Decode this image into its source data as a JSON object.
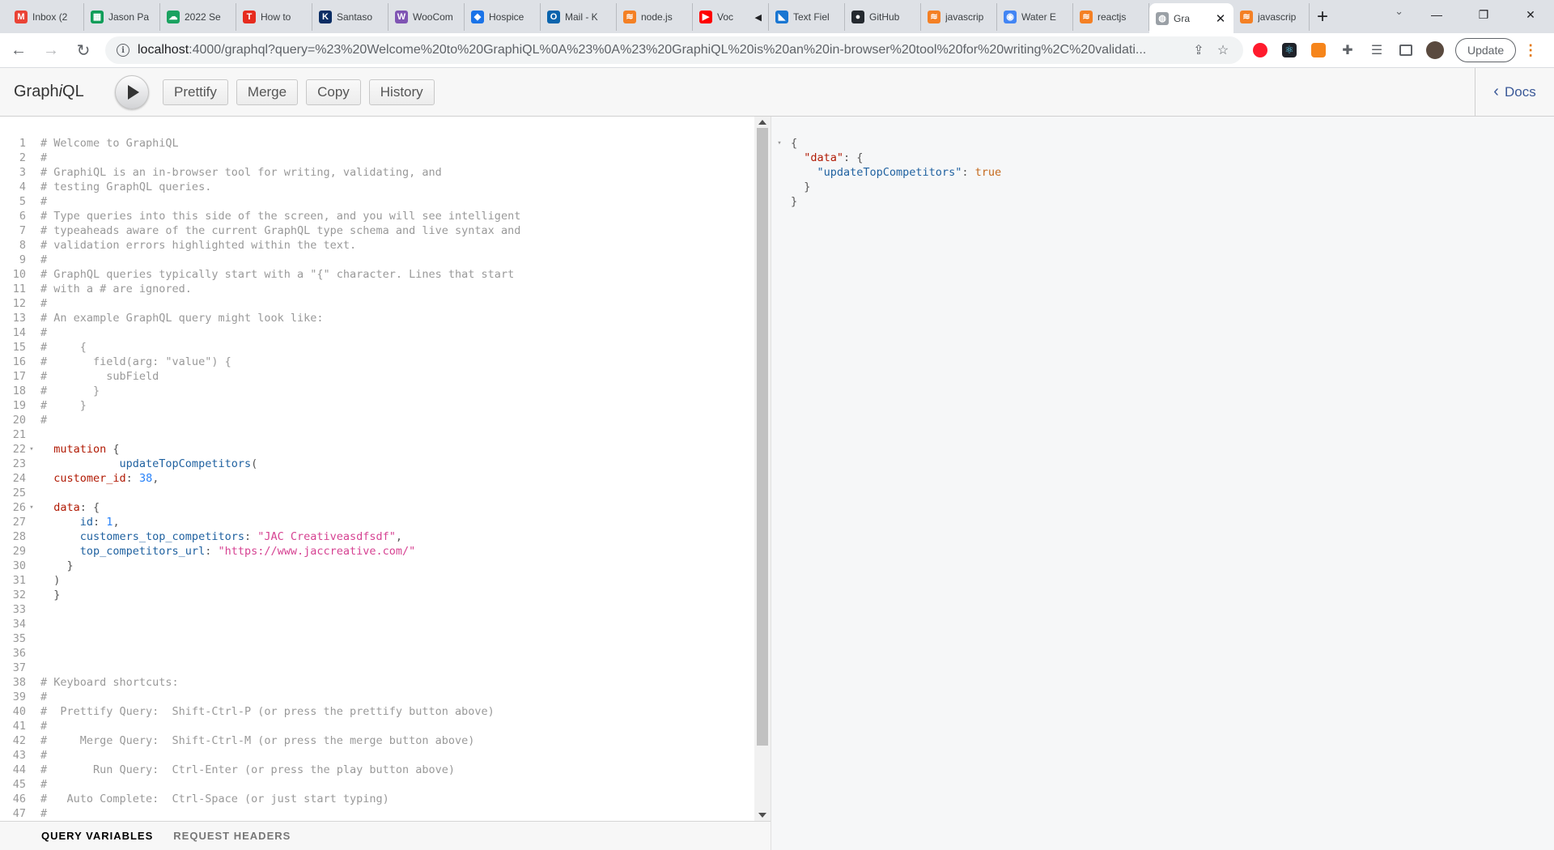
{
  "browser": {
    "tabs": [
      {
        "title": "Inbox (2",
        "icon": "gmail-icon",
        "color": "#ea4335",
        "glyph": "M"
      },
      {
        "title": "Jason Pa",
        "icon": "sheets-icon",
        "color": "#0f9d58",
        "glyph": "▦"
      },
      {
        "title": "2022 Se",
        "icon": "cloud-icon",
        "color": "#1aa260",
        "glyph": "☁"
      },
      {
        "title": "How to",
        "icon": "ted-icon",
        "color": "#e62b1e",
        "glyph": "T"
      },
      {
        "title": "Santaso",
        "icon": "k-icon",
        "color": "#0b2d64",
        "glyph": "K"
      },
      {
        "title": "WooCom",
        "icon": "woo-icon",
        "color": "#7f54b3",
        "glyph": "W"
      },
      {
        "title": "Hospice",
        "icon": "diamond-icon",
        "color": "#1a73e8",
        "glyph": "◆"
      },
      {
        "title": "Mail - K",
        "icon": "outlook-icon",
        "color": "#0a64ad",
        "glyph": "O"
      },
      {
        "title": "node.js",
        "icon": "stackoverflow-icon",
        "color": "#f48024",
        "glyph": "≋"
      },
      {
        "title": "Voc",
        "icon": "youtube-icon",
        "color": "#ff0000",
        "glyph": "▶",
        "audio": true
      },
      {
        "title": "Text Fiel",
        "icon": "mui-icon",
        "color": "#1976d2",
        "glyph": "◣"
      },
      {
        "title": "GitHub",
        "icon": "github-icon",
        "color": "#24292f",
        "glyph": "●"
      },
      {
        "title": "javascrip",
        "icon": "stackoverflow-icon",
        "color": "#f48024",
        "glyph": "≋"
      },
      {
        "title": "Water E",
        "icon": "water-icon",
        "color": "#4285f4",
        "glyph": "◉"
      },
      {
        "title": "reactjs",
        "icon": "stackoverflow-icon",
        "color": "#f48024",
        "glyph": "≋"
      },
      {
        "title": "Gra",
        "icon": "globe-icon",
        "color": "#9aa0a6",
        "glyph": "◍",
        "active": true
      },
      {
        "title": "javascrip",
        "icon": "stackoverflow-icon",
        "color": "#f48024",
        "glyph": "≋"
      }
    ],
    "url_host": "localhost",
    "url_rest": ":4000/graphql?query=%23%20Welcome%20to%20GraphiQL%0A%23%0A%23%20GraphiQL%20is%20an%20in-browser%20tool%20for%20writing%2C%20validati...",
    "update_label": "Update"
  },
  "graphiql": {
    "logo_pre": "Graph",
    "logo_em": "i",
    "logo_post": "QL",
    "buttons": {
      "prettify": "Prettify",
      "merge": "Merge",
      "copy": "Copy",
      "history": "History"
    },
    "docs_label": "Docs",
    "vars_tabs": {
      "variables": "QUERY VARIABLES",
      "headers": "REQUEST HEADERS"
    }
  },
  "query_lines": [
    {
      "n": 1,
      "t": [
        [
          "c-comment",
          "# Welcome to GraphiQL"
        ]
      ]
    },
    {
      "n": 2,
      "t": [
        [
          "c-comment",
          "#"
        ]
      ]
    },
    {
      "n": 3,
      "t": [
        [
          "c-comment",
          "# GraphiQL is an in-browser tool for writing, validating, and"
        ]
      ]
    },
    {
      "n": 4,
      "t": [
        [
          "c-comment",
          "# testing GraphQL queries."
        ]
      ]
    },
    {
      "n": 5,
      "t": [
        [
          "c-comment",
          "#"
        ]
      ]
    },
    {
      "n": 6,
      "t": [
        [
          "c-comment",
          "# Type queries into this side of the screen, and you will see intelligent"
        ]
      ]
    },
    {
      "n": 7,
      "t": [
        [
          "c-comment",
          "# typeaheads aware of the current GraphQL type schema and live syntax and"
        ]
      ]
    },
    {
      "n": 8,
      "t": [
        [
          "c-comment",
          "# validation errors highlighted within the text."
        ]
      ]
    },
    {
      "n": 9,
      "t": [
        [
          "c-comment",
          "#"
        ]
      ]
    },
    {
      "n": 10,
      "t": [
        [
          "c-comment",
          "# GraphQL queries typically start with a \"{\" character. Lines that start"
        ]
      ]
    },
    {
      "n": 11,
      "t": [
        [
          "c-comment",
          "# with a # are ignored."
        ]
      ]
    },
    {
      "n": 12,
      "t": [
        [
          "c-comment",
          "#"
        ]
      ]
    },
    {
      "n": 13,
      "t": [
        [
          "c-comment",
          "# An example GraphQL query might look like:"
        ]
      ]
    },
    {
      "n": 14,
      "t": [
        [
          "c-comment",
          "#"
        ]
      ]
    },
    {
      "n": 15,
      "t": [
        [
          "c-comment",
          "#     {"
        ]
      ]
    },
    {
      "n": 16,
      "t": [
        [
          "c-comment",
          "#       field(arg: \"value\") {"
        ]
      ]
    },
    {
      "n": 17,
      "t": [
        [
          "c-comment",
          "#         subField"
        ]
      ]
    },
    {
      "n": 18,
      "t": [
        [
          "c-comment",
          "#       }"
        ]
      ]
    },
    {
      "n": 19,
      "t": [
        [
          "c-comment",
          "#     }"
        ]
      ]
    },
    {
      "n": 20,
      "t": [
        [
          "c-comment",
          "#"
        ]
      ]
    },
    {
      "n": 21,
      "t": []
    },
    {
      "n": 22,
      "fold": true,
      "t": [
        [
          "c-keyword",
          "  mutation"
        ],
        [
          "c-punct",
          " {"
        ]
      ]
    },
    {
      "n": 23,
      "t": [
        [
          "c-prop",
          "            updateTopCompetitors"
        ],
        [
          "c-punct",
          "("
        ]
      ]
    },
    {
      "n": 24,
      "t": [
        [
          "c-keyword",
          "  customer_id"
        ],
        [
          "c-punct",
          ": "
        ],
        [
          "c-num",
          "38"
        ],
        [
          "c-punct",
          ","
        ]
      ]
    },
    {
      "n": 25,
      "t": []
    },
    {
      "n": 26,
      "fold": true,
      "t": [
        [
          "c-keyword",
          "  data"
        ],
        [
          "c-punct",
          ": {"
        ]
      ]
    },
    {
      "n": 27,
      "t": [
        [
          "c-prop",
          "      id"
        ],
        [
          "c-punct",
          ": "
        ],
        [
          "c-num",
          "1"
        ],
        [
          "c-punct",
          ","
        ]
      ]
    },
    {
      "n": 28,
      "t": [
        [
          "c-prop",
          "      customers_top_competitors"
        ],
        [
          "c-punct",
          ": "
        ],
        [
          "c-str",
          "\"JAC Creativeasdfsdf\""
        ],
        [
          "c-punct",
          ","
        ]
      ]
    },
    {
      "n": 29,
      "t": [
        [
          "c-prop",
          "      top_competitors_url"
        ],
        [
          "c-punct",
          ": "
        ],
        [
          "c-str",
          "\"https://www.jaccreative.com/\""
        ]
      ]
    },
    {
      "n": 30,
      "t": [
        [
          "c-punct",
          "    }"
        ]
      ]
    },
    {
      "n": 31,
      "t": [
        [
          "c-punct",
          "  )"
        ]
      ]
    },
    {
      "n": 32,
      "t": [
        [
          "c-punct",
          "  }"
        ]
      ]
    },
    {
      "n": 33,
      "t": []
    },
    {
      "n": 34,
      "t": []
    },
    {
      "n": 35,
      "t": []
    },
    {
      "n": 36,
      "t": []
    },
    {
      "n": 37,
      "t": []
    },
    {
      "n": 38,
      "t": [
        [
          "c-comment",
          "# Keyboard shortcuts:"
        ]
      ]
    },
    {
      "n": 39,
      "t": [
        [
          "c-comment",
          "#"
        ]
      ]
    },
    {
      "n": 40,
      "t": [
        [
          "c-comment",
          "#  Prettify Query:  Shift-Ctrl-P (or press the prettify button above)"
        ]
      ]
    },
    {
      "n": 41,
      "t": [
        [
          "c-comment",
          "#"
        ]
      ]
    },
    {
      "n": 42,
      "t": [
        [
          "c-comment",
          "#     Merge Query:  Shift-Ctrl-M (or press the merge button above)"
        ]
      ]
    },
    {
      "n": 43,
      "t": [
        [
          "c-comment",
          "#"
        ]
      ]
    },
    {
      "n": 44,
      "t": [
        [
          "c-comment",
          "#       Run Query:  Ctrl-Enter (or press the play button above)"
        ]
      ]
    },
    {
      "n": 45,
      "t": [
        [
          "c-comment",
          "#"
        ]
      ]
    },
    {
      "n": 46,
      "t": [
        [
          "c-comment",
          "#   Auto Complete:  Ctrl-Space (or just start typing)"
        ]
      ]
    },
    {
      "n": 47,
      "t": [
        [
          "c-comment",
          "#"
        ]
      ]
    }
  ],
  "result_lines": [
    {
      "fold": true,
      "t": [
        [
          "c-punct",
          "{"
        ]
      ]
    },
    {
      "t": [
        [
          "c-attr",
          "  \"data\""
        ],
        [
          "c-punct",
          ": {"
        ]
      ]
    },
    {
      "t": [
        [
          "c-prop",
          "    \"updateTopCompetitors\""
        ],
        [
          "c-punct",
          ": "
        ],
        [
          "c-bool",
          "true"
        ]
      ]
    },
    {
      "t": [
        [
          "c-punct",
          "  }"
        ]
      ]
    },
    {
      "t": [
        [
          "c-punct",
          "}"
        ]
      ]
    }
  ]
}
